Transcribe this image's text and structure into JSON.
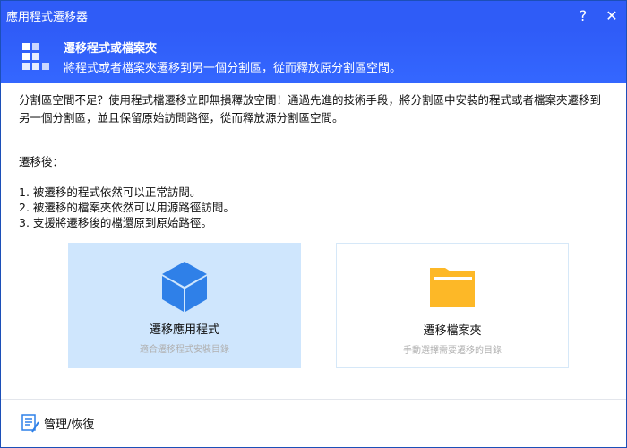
{
  "window": {
    "title": "應用程式遷移器",
    "help_label": "?",
    "close_label": "✕"
  },
  "header": {
    "icon": "grid-icon",
    "title": "遷移程式或檔案夾",
    "subtitle": "將程式或者檔案夾遷移到另一個分割區，從而釋放原分割區空間。"
  },
  "description": "分割區空間不足？使用程式檔遷移立即無損釋放空間！通過先進的技術手段，將分割區中安裝的程式或者檔案夾遷移到另一個分割區，並且保留原始訪問路徑，從而釋放源分割區空間。",
  "after_label": "遷移後：",
  "benefits": [
    "1. 被遷移的程式依然可以正常訪問。",
    "2. 被遷移的檔案夾依然可以用源路徑訪問。",
    "3. 支援將遷移後的檔還原到原始路徑。"
  ],
  "options": [
    {
      "title": "遷移應用程式",
      "subtitle": "適合遷移程式安裝目錄",
      "icon": "cube-icon",
      "selected": true
    },
    {
      "title": "遷移檔案夾",
      "subtitle": "手動選擇需要遷移的目錄",
      "icon": "folder-icon",
      "selected": false
    }
  ],
  "footer": {
    "manage_label": "管理/恢復"
  },
  "colors": {
    "accent": "#2f5cf7",
    "cube": "#2f80e8",
    "folder": "#fdb827",
    "selected_bg": "#cfe6fd"
  }
}
